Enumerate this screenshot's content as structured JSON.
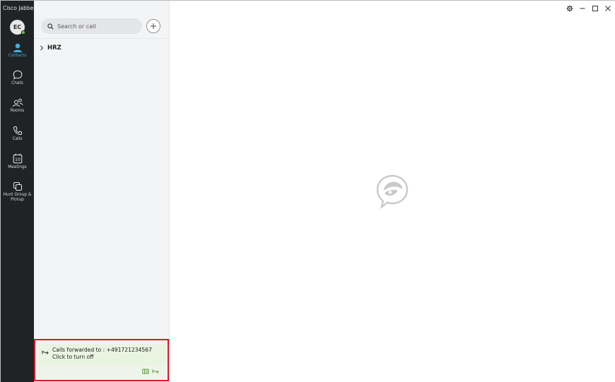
{
  "app": {
    "title": "Cisco Jabber"
  },
  "user": {
    "initials": "EC",
    "presence_color": "#6cc04a"
  },
  "nav": {
    "items": [
      {
        "label": "Contacts",
        "icon": "person-icon",
        "active": true
      },
      {
        "label": "Chats",
        "icon": "chat-bubble-icon"
      },
      {
        "label": "Rooms",
        "icon": "rooms-icon"
      },
      {
        "label": "Calls",
        "icon": "phone-icon"
      },
      {
        "label": "Meetings",
        "icon": "calendar-icon",
        "badge": "10"
      },
      {
        "label": "Hunt Group & Pickup",
        "icon": "hunt-group-icon"
      }
    ]
  },
  "search": {
    "placeholder": "Search or call"
  },
  "contacts": {
    "groups": [
      {
        "name": "HRZ",
        "expanded": false
      }
    ]
  },
  "forward": {
    "line1": "Calls forwarded to  : +491721234567",
    "line2": "Click to turn off"
  },
  "colors": {
    "rail": "#1f2325",
    "accent": "#3fb0e4",
    "highlight_border": "#e0191e",
    "banner": "#e9f5e1"
  }
}
